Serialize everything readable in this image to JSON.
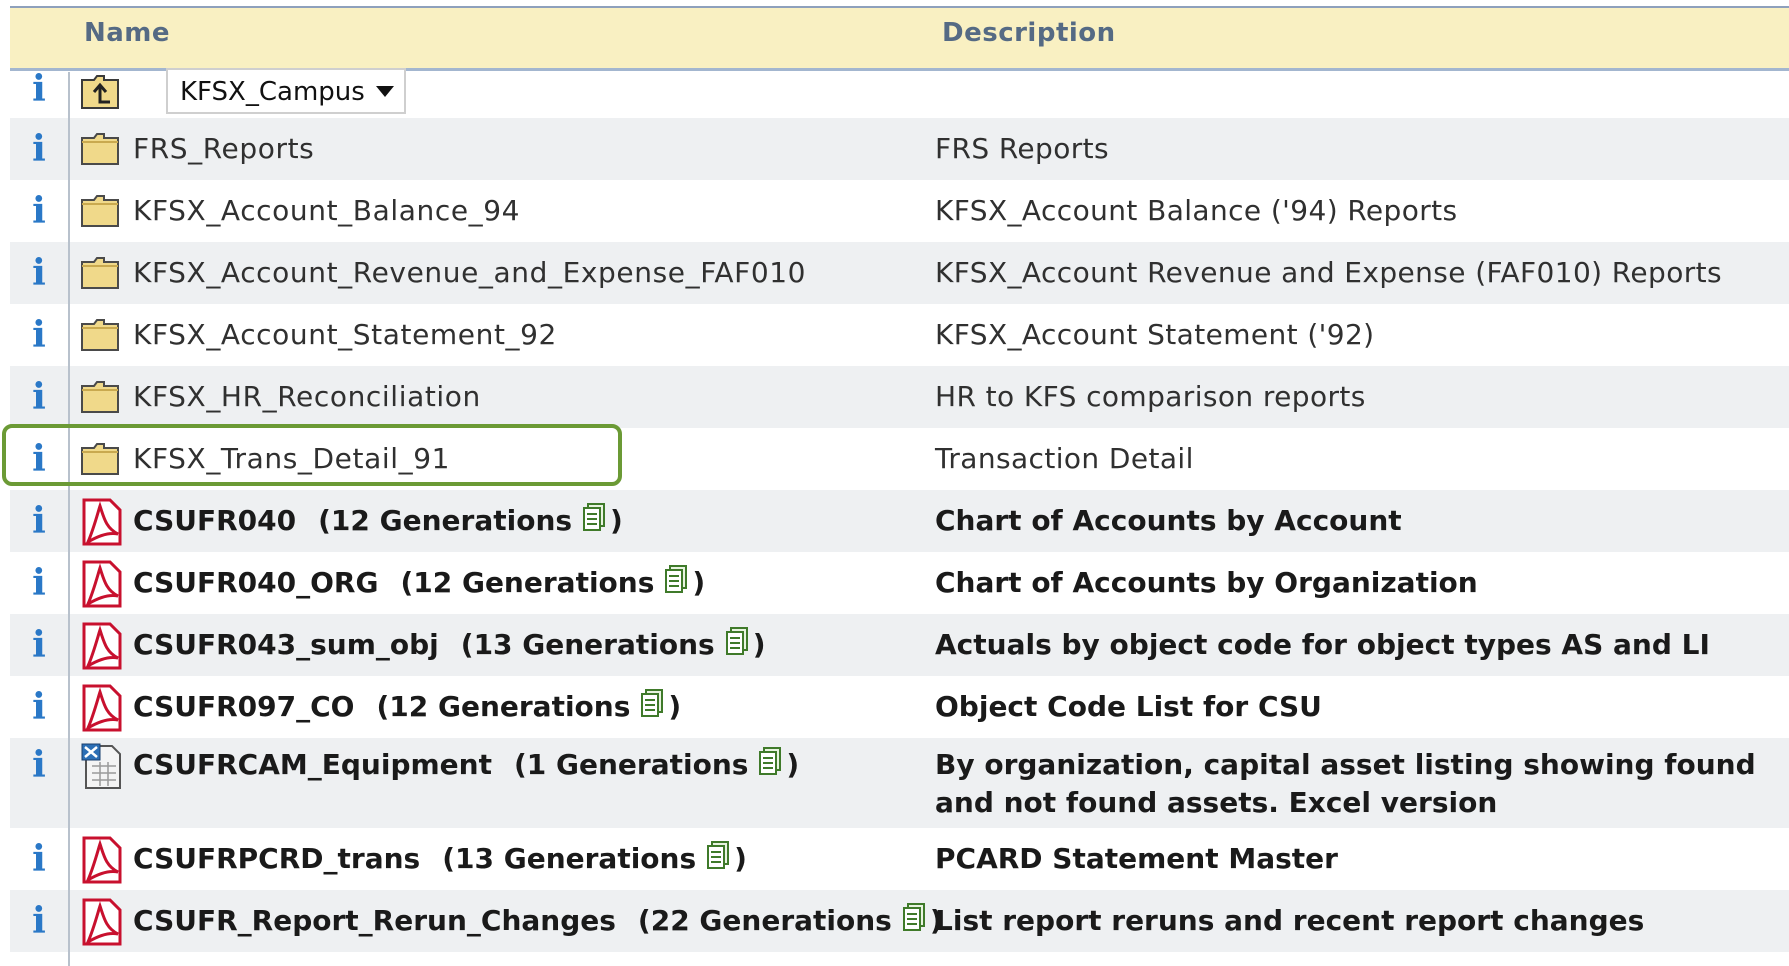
{
  "header": {
    "name_label": "Name",
    "description_label": "Description"
  },
  "info_glyph": "i",
  "folder_nav": {
    "selected": "KFSX_Campus"
  },
  "rows": [
    {
      "type": "folder",
      "name": "FRS_Reports",
      "description": "FRS Reports"
    },
    {
      "type": "folder",
      "name": "KFSX_Account_Balance_94",
      "description": "KFSX_Account Balance ('94) Reports"
    },
    {
      "type": "folder",
      "name": "KFSX_Account_Revenue_and_Expense_FAF010",
      "description": "KFSX_Account Revenue and Expense (FAF010) Reports"
    },
    {
      "type": "folder",
      "name": "KFSX_Account_Statement_92",
      "description": "KFSX_Account Statement ('92)"
    },
    {
      "type": "folder",
      "name": "KFSX_HR_Reconciliation",
      "description": "HR to KFS comparison reports"
    },
    {
      "type": "folder",
      "name": "KFSX_Trans_Detail_91",
      "description": "Transaction Detail",
      "highlighted": true
    },
    {
      "type": "pdf",
      "name": "CSUFR040",
      "generations": "(12 Generations",
      "close": ")",
      "description": "Chart of Accounts by Account"
    },
    {
      "type": "pdf",
      "name": "CSUFR040_ORG",
      "generations": "(12 Generations",
      "close": ")",
      "description": "Chart of Accounts by Organization"
    },
    {
      "type": "pdf",
      "name": "CSUFR043_sum_obj",
      "generations": "(13 Generations",
      "close": ")",
      "description": "Actuals by object code for object types AS and LI"
    },
    {
      "type": "pdf",
      "name": "CSUFR097_CO",
      "generations": "(12 Generations",
      "close": ")",
      "description": "Object Code List for CSU"
    },
    {
      "type": "excel",
      "name": "CSUFRCAM_Equipment",
      "generations": "(1 Generations",
      "close": ")",
      "description": "By organization, capital asset listing showing found and not found assets. Excel version"
    },
    {
      "type": "pdf",
      "name": "CSUFRPCRD_trans",
      "generations": "(13 Generations",
      "close": ")",
      "description": "PCARD Statement Master"
    },
    {
      "type": "pdf",
      "name": "CSUFR_Report_Rerun_Changes",
      "generations": "(22 Generations",
      "close": ")",
      "description": "List report reruns and recent report changes"
    }
  ],
  "colors": {
    "header_bg": "#f9f0c2",
    "alt_row": "#eef0f2",
    "info": "#2a78c7",
    "highlight": "#6b9a35",
    "pdf_red": "#c8102e"
  }
}
